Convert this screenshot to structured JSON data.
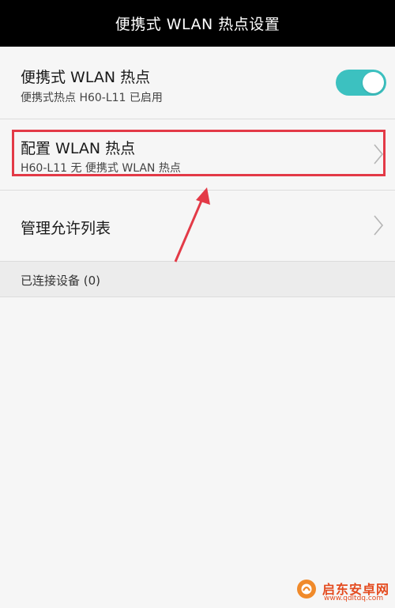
{
  "header": {
    "title": "便携式 WLAN 热点设置"
  },
  "hotspot": {
    "title": "便携式 WLAN 热点",
    "subtitle": "便携式热点 H60-L11 已启用",
    "enabled": true,
    "accent_color": "#3cc1c0"
  },
  "config": {
    "title": "配置 WLAN 热点",
    "subtitle": "H60-L11 无 便携式 WLAN 热点"
  },
  "allow_list": {
    "title": "管理允许列表"
  },
  "connected_devices": {
    "label": "已连接设备 (0)"
  },
  "watermark": {
    "name": "启东安卓网",
    "url": "www.qdltdq.com"
  },
  "annotation_color": "#e33a47"
}
